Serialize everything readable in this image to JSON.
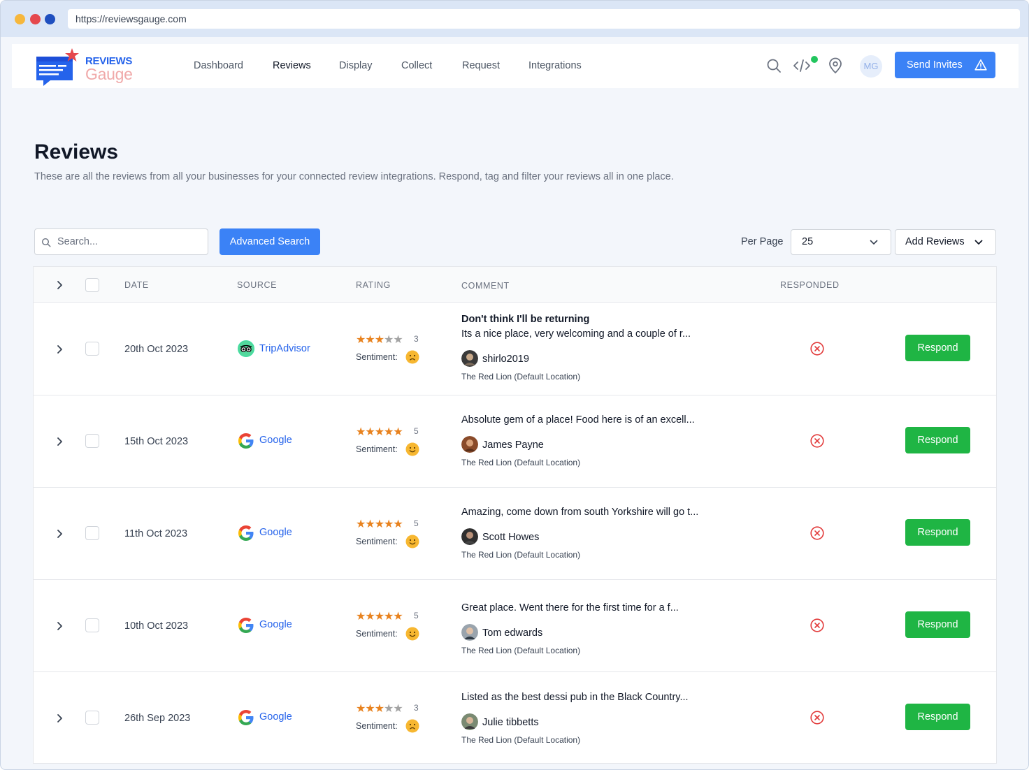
{
  "browser": {
    "url": "https://reviewsgauge.com"
  },
  "brand": {
    "line1": "REVIEWS",
    "line2": "Gauge"
  },
  "nav": [
    {
      "label": "Dashboard"
    },
    {
      "label": "Reviews",
      "active": true
    },
    {
      "label": "Display"
    },
    {
      "label": "Collect"
    },
    {
      "label": "Request"
    },
    {
      "label": "Integrations"
    }
  ],
  "header_icons": [
    "search-icon",
    "code-icon",
    "location-pin-icon"
  ],
  "user": {
    "initials": "MG"
  },
  "send_invites": {
    "label": "Send Invites"
  },
  "page": {
    "title": "Reviews",
    "description": "These are all the reviews from all your businesses for your connected review integrations. Respond, tag and filter your reviews all in one place."
  },
  "toolbar": {
    "search_placeholder": "Search...",
    "advanced_search": "Advanced Search",
    "per_page_label": "Per Page",
    "per_page_value": "25",
    "add_reviews": "Add Reviews"
  },
  "table": {
    "columns": {
      "date": "DATE",
      "source": "SOURCE",
      "rating": "RATING",
      "comment": "COMMENT",
      "responded": "RESPONDED"
    },
    "sentiment_label": "Sentiment:",
    "respond_label": "Respond",
    "rows": [
      {
        "date": "20th Oct 2023",
        "source": "TripAdvisor",
        "rating": 3,
        "sentiment": "negative",
        "title": "Don't think I'll be returning",
        "comment": "Its a nice place, very welcoming and a couple of r...",
        "author": "shirlo2019",
        "location": "The Red Lion (Default Location)",
        "responded": false
      },
      {
        "date": "15th Oct 2023",
        "source": "Google",
        "rating": 5,
        "sentiment": "positive",
        "title": "",
        "comment": "Absolute gem of a place! Food here is of an excell...",
        "author": "James Payne",
        "location": "The Red Lion (Default Location)",
        "responded": false
      },
      {
        "date": "11th Oct 2023",
        "source": "Google",
        "rating": 5,
        "sentiment": "positive",
        "title": "",
        "comment": "Amazing, come down from south Yorkshire will go t...",
        "author": "Scott Howes",
        "location": "The Red Lion (Default Location)",
        "responded": false
      },
      {
        "date": "10th Oct 2023",
        "source": "Google",
        "rating": 5,
        "sentiment": "positive",
        "title": "",
        "comment": "Great place. Went there for the first time for a f...",
        "author": "Tom edwards",
        "location": "The Red Lion (Default Location)",
        "responded": false
      },
      {
        "date": "26th Sep 2023",
        "source": "Google",
        "rating": 3,
        "sentiment": "negative",
        "title": "",
        "comment": "Listed as the best dessi pub in the Black Country...",
        "author": "Julie tibbetts",
        "location": "The Red Lion (Default Location)",
        "responded": false
      }
    ]
  },
  "colors": {
    "primary": "#3b82f6",
    "respond_green": "#1fb544",
    "star": "#e8821e",
    "not_responded": "#e23b3b",
    "link": "#2563eb"
  }
}
